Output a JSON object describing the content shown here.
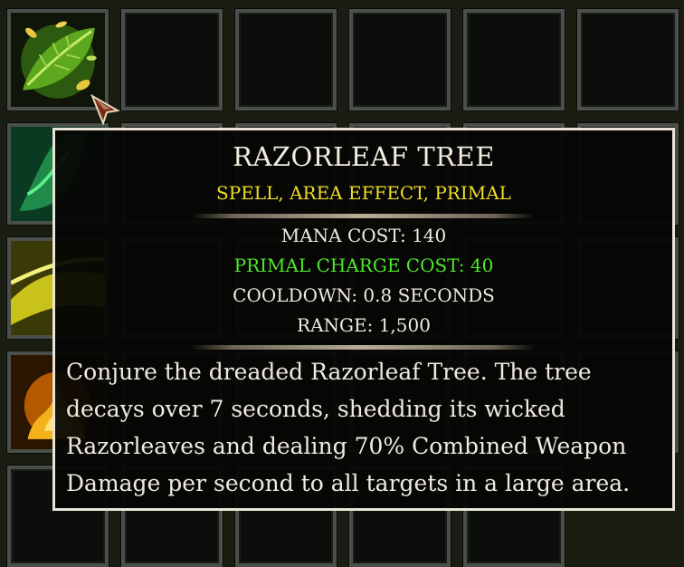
{
  "inventory": {
    "slot_count": 29,
    "icons": [
      "razorleaf-spell-icon",
      "green-spell-icon",
      "yellow-spell-icon",
      "fire-spell-icon"
    ]
  },
  "tooltip": {
    "title": "RAZORLEAF TREE",
    "subtitle": "SPELL, AREA EFFECT, PRIMAL",
    "stats": [
      {
        "label": "MANA COST:",
        "value": "140"
      },
      {
        "label": "PRIMAL CHARGE COST:",
        "value": "40"
      },
      {
        "label": "COOLDOWN:",
        "value": "0.8 SECONDS"
      },
      {
        "label": "RANGE:",
        "value": "1,500"
      }
    ],
    "description": "Conjure the dreaded Razorleaf Tree. The tree decays over 7 seconds, shedding its wicked Razorleaves and dealing 70% Combined Weapon Damage per second to all targets in a large area."
  },
  "colors": {
    "title": "#f3ede0",
    "subtitle": "#f0dd28",
    "primal_stat": "#4fe82c",
    "border": "#e9e4d6"
  }
}
